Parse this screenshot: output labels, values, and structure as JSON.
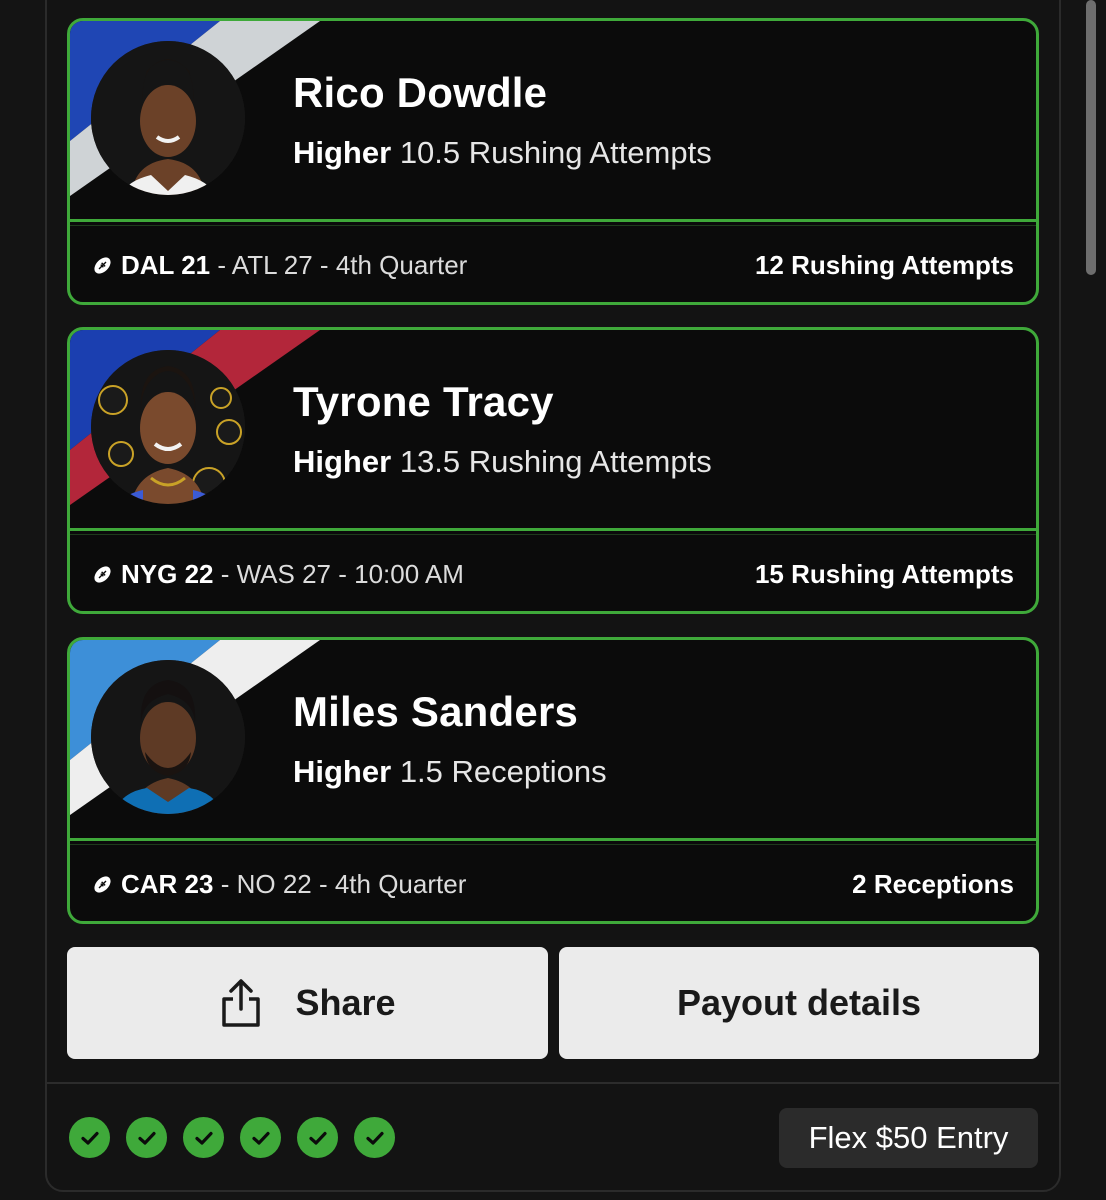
{
  "picks": [
    {
      "player": "Rico Dowdle",
      "direction": "Higher",
      "line": "10.5 Rushing Attempts",
      "team_score": "DAL 21",
      "opponent_status": " - ATL 27 - 4th Quarter",
      "result": "12 Rushing Attempts",
      "stripe_colors": [
        "#1f46b4",
        "#cfd3d6"
      ],
      "avatar_icon": "player-headshot"
    },
    {
      "player": "Tyrone Tracy",
      "direction": "Higher",
      "line": "13.5 Rushing Attempts",
      "team_score": "NYG 22",
      "opponent_status": " - WAS 27 - 10:00 AM",
      "result": "15 Rushing Attempts",
      "stripe_colors": [
        "#1b3fb0",
        "#b3263a"
      ],
      "avatar_icon": "player-headshot"
    },
    {
      "player": "Miles Sanders",
      "direction": "Higher",
      "line": "1.5 Receptions",
      "team_score": "CAR 23",
      "opponent_status": " - NO 22 - 4th Quarter",
      "result": "2 Receptions",
      "stripe_colors": [
        "#3d8fd8",
        "#eeeeee"
      ],
      "avatar_icon": "player-headshot"
    }
  ],
  "actions": {
    "share_label": "Share",
    "payout_label": "Payout details"
  },
  "footer": {
    "completed_legs": 6,
    "entry_label": "Flex $50 Entry"
  },
  "colors": {
    "accent_green": "#3fa93a",
    "background": "#131313",
    "card": "#0b0b0b"
  }
}
